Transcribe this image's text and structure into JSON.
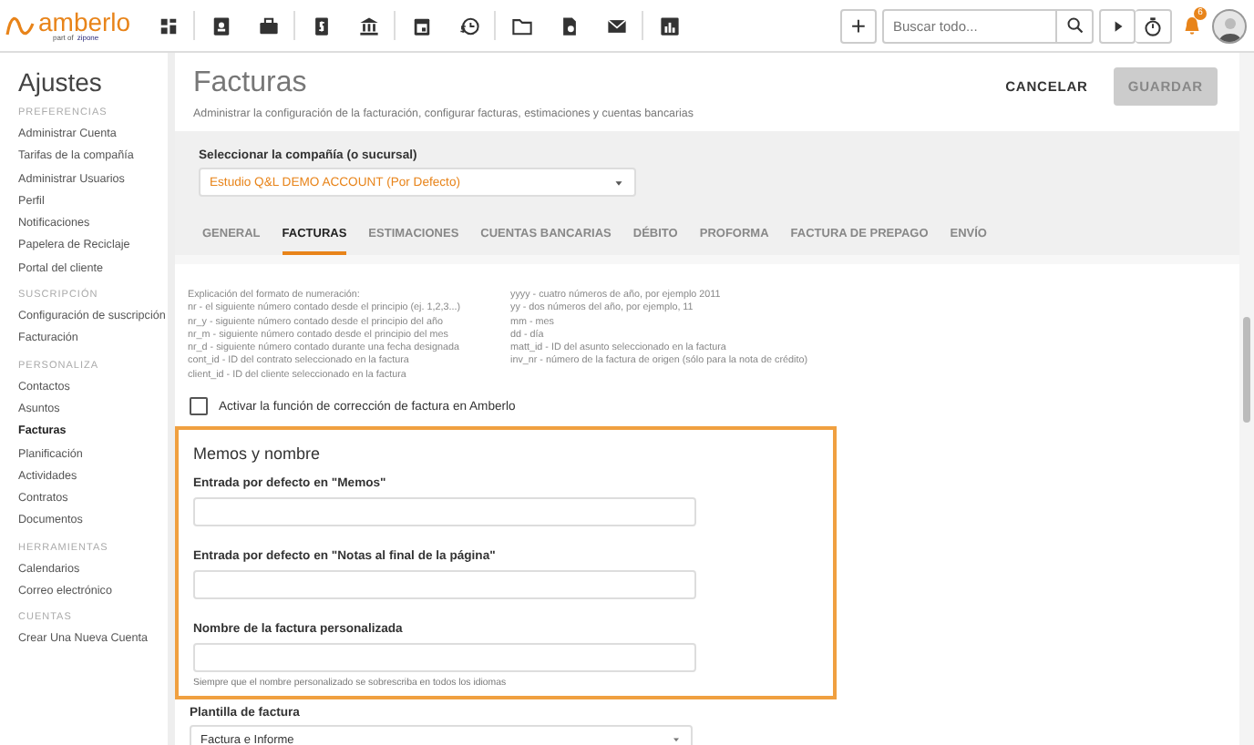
{
  "topbar": {
    "logo": "amberlo",
    "logo_sub": "part of",
    "logo_partner": "zipone",
    "search": {
      "placeholder": "Buscar todo..."
    },
    "add": "+",
    "notifications": "6"
  },
  "sidebar": {
    "title": "Ajustes",
    "sections": [
      {
        "heading": "PREFERENCIAS",
        "items": [
          {
            "label": "Administrar Cuenta",
            "selected": false
          },
          {
            "label": "Tarifas de la compañía",
            "selected": false
          },
          {
            "label": "Administrar Usuarios",
            "selected": false
          },
          {
            "label": "Perfil",
            "selected": false
          },
          {
            "label": "Notificaciones",
            "selected": false
          },
          {
            "label": "Papelera de Reciclaje",
            "selected": false
          },
          {
            "label": "Portal del cliente",
            "selected": false
          }
        ]
      },
      {
        "heading": "SUSCRIPCIÓN",
        "items": [
          {
            "label": "Configuración de suscripción",
            "selected": false
          },
          {
            "label": "Facturación",
            "selected": false
          }
        ]
      },
      {
        "heading": "PERSONALIZA",
        "items": [
          {
            "label": "Contactos",
            "selected": false
          },
          {
            "label": "Asuntos",
            "selected": false
          },
          {
            "label": "Facturas",
            "selected": true
          },
          {
            "label": "Planificación",
            "selected": false
          },
          {
            "label": "Actividades",
            "selected": false
          },
          {
            "label": "Contratos",
            "selected": false
          },
          {
            "label": "Documentos",
            "selected": false
          }
        ]
      },
      {
        "heading": "HERRAMIENTAS",
        "items": [
          {
            "label": "Calendarios",
            "selected": false
          },
          {
            "label": "Correo electrónico",
            "selected": false
          }
        ]
      },
      {
        "heading": "CUENTAS",
        "items": [
          {
            "label": "Crear Una Nueva Cuenta",
            "selected": false
          }
        ]
      }
    ]
  },
  "header": {
    "title": "Facturas",
    "description": "Administrar la configuración de la facturación, configurar facturas, estimaciones y cuentas bancarias",
    "buttons": [
      {
        "label": "CANCELAR",
        "disabled": false
      },
      {
        "label": "GUARDAR",
        "disabled": true
      }
    ]
  },
  "company": {
    "label": "Seleccionar la compañía (o sucursal)",
    "value": "Estudio Q&L DEMO ACCOUNT (Por Defecto)"
  },
  "tabs": [
    {
      "label": "GENERAL",
      "selected": false
    },
    {
      "label": "FACTURAS",
      "selected": true
    },
    {
      "label": "ESTIMACIONES",
      "selected": false
    },
    {
      "label": "CUENTAS BANCARIAS",
      "selected": false
    },
    {
      "label": "DÉBITO",
      "selected": false
    },
    {
      "label": "PROFORMA",
      "selected": false
    },
    {
      "label": "FACTURA DE PREPAGO",
      "selected": false
    },
    {
      "label": "ENVÍO",
      "selected": false
    }
  ],
  "numbering_help": {
    "left": [
      "Explicación del formato de numeración:",
      "nr - el siguiente número contado desde el principio (ej. 1,2,3...)",
      "nr_y - siguiente número contado desde el principio del año",
      "nr_m - siguiente número contado desde el principio del mes",
      "nr_d - siguiente número contado durante una fecha designada",
      "cont_id - ID del contrato seleccionado en la factura",
      "client_id - ID del cliente seleccionado en la factura"
    ],
    "right": [
      "yyyy - cuatro números de año, por ejemplo 2011",
      "yy - dos números del año, por ejemplo, 11",
      "mm - mes",
      "dd - día",
      "matt_id - ID del asunto seleccionado en la factura",
      "inv_nr - número de la factura de origen (sólo para la nota de crédito)"
    ]
  },
  "correction": {
    "label": "Activar la función de corrección de factura en Amberlo",
    "checked": false
  },
  "memos": {
    "title": "Memos y nombre",
    "highlighted": true,
    "fields": [
      {
        "label": "Entrada por defecto en \"Memos\""
      },
      {
        "label": "Entrada por defecto en \"Notas al final de la página\""
      },
      {
        "label": "Nombre de la factura personalizada",
        "hint": "Siempre que el nombre personalizado se sobrescriba en todos los idiomas"
      }
    ]
  },
  "template": {
    "label": "Plantilla de factura",
    "value": "Factura e Informe"
  }
}
